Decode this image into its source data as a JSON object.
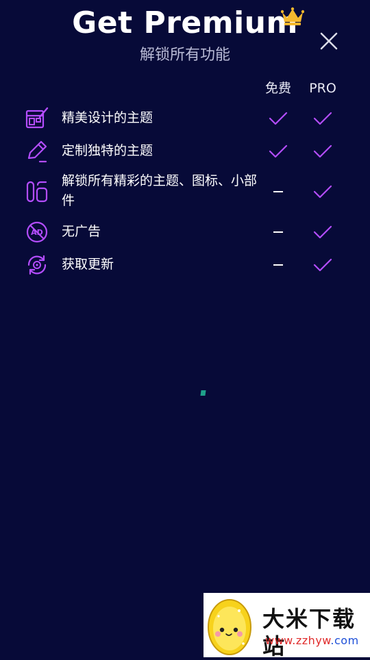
{
  "header": {
    "title": "Get Premium",
    "subtitle": "解锁所有功能"
  },
  "columns": {
    "free": "免费",
    "pro": "PRO"
  },
  "features": [
    {
      "label": "精美设计的主题",
      "icon": "theme-design-icon",
      "free": "check",
      "pro": "check"
    },
    {
      "label": "定制独特的主题",
      "icon": "pencil-icon",
      "free": "check",
      "pro": "check"
    },
    {
      "label": "解锁所有精彩的主题、图标、小部件",
      "icon": "widget-icon",
      "free": "dash",
      "pro": "check"
    },
    {
      "label": "无广告",
      "icon": "no-ads-icon",
      "free": "dash",
      "pro": "check"
    },
    {
      "label": "获取更新",
      "icon": "update-icon",
      "free": "dash",
      "pro": "check"
    }
  ],
  "watermark": {
    "name": "大米下载站",
    "url_part1": "www.zzhyw",
    "url_part2": ".com"
  },
  "colors": {
    "background": "#070a38",
    "accent": "#b44dff",
    "crown": "#f5b82e"
  }
}
